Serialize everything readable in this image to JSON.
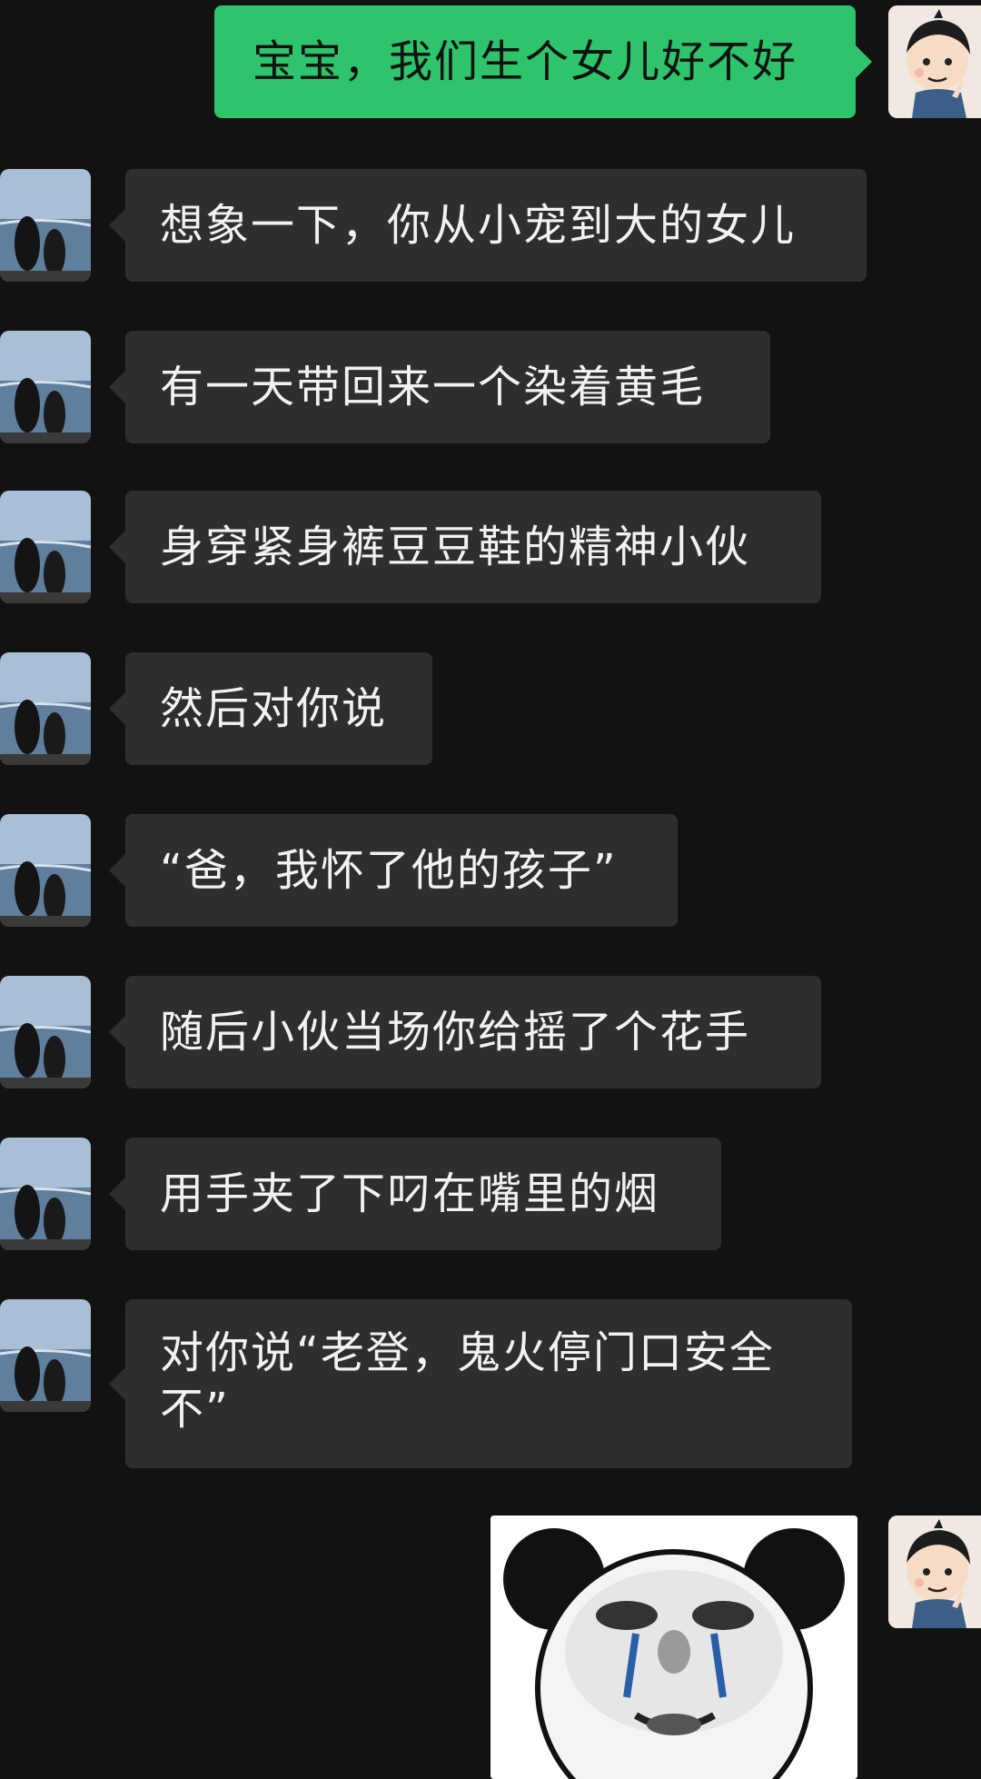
{
  "messages": [
    {
      "side": "out",
      "text": "宝宝，我们生个女儿好不好"
    },
    {
      "side": "in",
      "text": "想象一下，你从小宠到大的女儿"
    },
    {
      "side": "in",
      "text": "有一天带回来一个染着黄毛"
    },
    {
      "side": "in",
      "text": "身穿紧身裤豆豆鞋的精神小伙"
    },
    {
      "side": "in",
      "text": "然后对你说"
    },
    {
      "side": "in",
      "text": "“爸，我怀了他的孩子”"
    },
    {
      "side": "in",
      "text": "随后小伙当场你给摇了个花手"
    },
    {
      "side": "in",
      "text": "用手夹了下叼在嘴里的烟"
    },
    {
      "side": "in",
      "text": "对你说“老登，鬼火停门口安全不”"
    }
  ],
  "sticker": {
    "icon": "crying-panda-meme-icon"
  },
  "colors": {
    "background": "#121212",
    "incoming_bubble": "#2e2e2e",
    "outgoing_bubble": "#2ec46b"
  }
}
